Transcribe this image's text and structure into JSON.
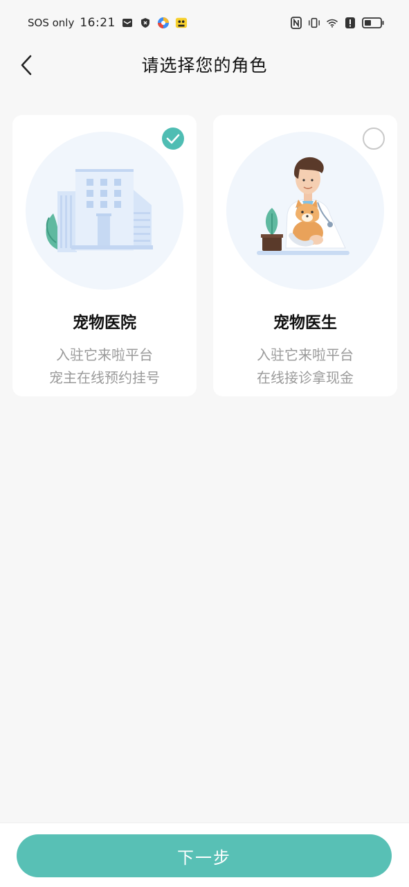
{
  "status_bar": {
    "carrier": "SOS only",
    "time": "16:21"
  },
  "header": {
    "title": "请选择您的角色"
  },
  "roles": [
    {
      "title": "宠物医院",
      "line1": "入驻它来啦平台",
      "line2": "宠主在线预约挂号",
      "selected": true
    },
    {
      "title": "宠物医生",
      "line1": "入驻它来啦平台",
      "line2": "在线接诊拿现金",
      "selected": false
    }
  ],
  "footer": {
    "next_label": "下一步"
  },
  "colors": {
    "accent": "#58c0b5",
    "check": "#4fbdb3",
    "background": "#f7f7f7"
  }
}
